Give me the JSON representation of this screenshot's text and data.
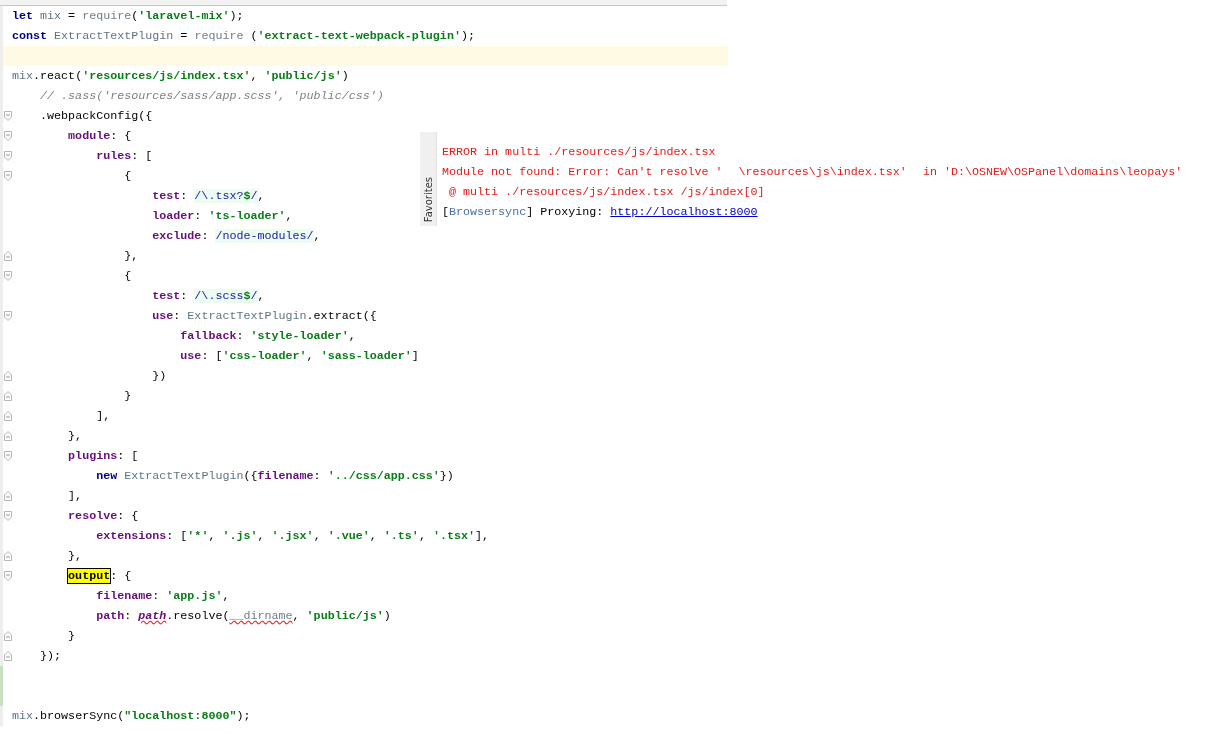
{
  "editor": {
    "lines": [
      {
        "tokens": [
          {
            "kind": "kw",
            "t": "let"
          },
          {
            "kind": "global",
            "t": " mix"
          },
          {
            "kind": "punct",
            "t": " = "
          },
          {
            "kind": "fn",
            "t": "require"
          },
          {
            "kind": "punct",
            "t": "("
          },
          {
            "kind": "str",
            "t": "'laravel-mix'"
          },
          {
            "kind": "punct",
            "t": ");"
          }
        ]
      },
      {
        "tokens": [
          {
            "kind": "kw",
            "t": "const"
          },
          {
            "kind": "global",
            "t": " ExtractTextPlugin"
          },
          {
            "kind": "punct",
            "t": " = "
          },
          {
            "kind": "fn",
            "t": "require"
          },
          {
            "kind": "punct",
            "t": " ("
          },
          {
            "kind": "str",
            "t": "'extract-text-webpack-plugin'"
          },
          {
            "kind": "punct",
            "t": ");"
          }
        ]
      },
      {
        "current": true
      },
      {
        "tokens": [
          {
            "kind": "global",
            "t": "mix"
          },
          {
            "kind": "punct",
            "t": "."
          },
          {
            "kind": "method",
            "t": "react"
          },
          {
            "kind": "punct",
            "t": "("
          },
          {
            "kind": "str",
            "t": "'resources/js/index.tsx'"
          },
          {
            "kind": "punct",
            "t": ", "
          },
          {
            "kind": "str",
            "t": "'public/js'"
          },
          {
            "kind": "punct",
            "t": ")"
          }
        ]
      },
      {
        "tokens": [
          {
            "kind": "comment",
            "t": "    // .sass('resources/sass/app.scss', 'public/css')"
          }
        ]
      },
      {
        "fold_start": true,
        "tokens": [
          {
            "kind": "punct",
            "t": "    ."
          },
          {
            "kind": "method",
            "t": "webpackConfig"
          },
          {
            "kind": "punct",
            "t": "({"
          }
        ]
      },
      {
        "fold_start": true,
        "tokens": [
          {
            "kind": "prop",
            "t": "        module"
          },
          {
            "kind": "punct",
            "t": ": {"
          }
        ]
      },
      {
        "fold_start": true,
        "tokens": [
          {
            "kind": "prop",
            "t": "            rules"
          },
          {
            "kind": "punct",
            "t": ": ["
          }
        ]
      },
      {
        "fold_start": true,
        "tokens": [
          {
            "kind": "punct",
            "t": "                {"
          }
        ]
      },
      {
        "tokens": [
          {
            "kind": "prop",
            "t": "                    test"
          },
          {
            "kind": "punct",
            "t": ": "
          },
          {
            "kind": "regex",
            "t": "/\\.tsx?"
          },
          {
            "kind": "regexop",
            "t": "$"
          },
          {
            "kind": "regex",
            "t": "/"
          },
          {
            "kind": "punct",
            "t": ","
          }
        ]
      },
      {
        "tokens": [
          {
            "kind": "prop",
            "t": "                    loader"
          },
          {
            "kind": "punct",
            "t": ": "
          },
          {
            "kind": "str",
            "t": "'ts-loader'"
          },
          {
            "kind": "punct",
            "t": ","
          }
        ]
      },
      {
        "tokens": [
          {
            "kind": "prop",
            "t": "                    exclude"
          },
          {
            "kind": "punct",
            "t": ": "
          },
          {
            "kind": "regex",
            "t": "/node-modules/"
          },
          {
            "kind": "punct",
            "t": ","
          }
        ]
      },
      {
        "fold_end": true,
        "tokens": [
          {
            "kind": "punct",
            "t": "                },"
          }
        ]
      },
      {
        "fold_start": true,
        "tokens": [
          {
            "kind": "punct",
            "t": "                {"
          }
        ]
      },
      {
        "tokens": [
          {
            "kind": "prop",
            "t": "                    test"
          },
          {
            "kind": "punct",
            "t": ": "
          },
          {
            "kind": "regex",
            "t": "/\\.scss"
          },
          {
            "kind": "regexop",
            "t": "$"
          },
          {
            "kind": "regex",
            "t": "/"
          },
          {
            "kind": "punct",
            "t": ","
          }
        ]
      },
      {
        "fold_start": true,
        "tokens": [
          {
            "kind": "prop",
            "t": "                    use"
          },
          {
            "kind": "punct",
            "t": ": "
          },
          {
            "kind": "global",
            "t": "ExtractTextPlugin"
          },
          {
            "kind": "punct",
            "t": "."
          },
          {
            "kind": "method",
            "t": "extract"
          },
          {
            "kind": "punct",
            "t": "({"
          }
        ]
      },
      {
        "tokens": [
          {
            "kind": "prop",
            "t": "                        fallback"
          },
          {
            "kind": "punct",
            "t": ": "
          },
          {
            "kind": "str",
            "t": "'style-loader'"
          },
          {
            "kind": "punct",
            "t": ","
          }
        ]
      },
      {
        "tokens": [
          {
            "kind": "prop",
            "t": "                        use"
          },
          {
            "kind": "punct",
            "t": ": ["
          },
          {
            "kind": "str",
            "t": "'css-loader'"
          },
          {
            "kind": "punct",
            "t": ", "
          },
          {
            "kind": "str",
            "t": "'sass-loader'"
          },
          {
            "kind": "punct",
            "t": "]"
          }
        ]
      },
      {
        "fold_end": true,
        "tokens": [
          {
            "kind": "punct",
            "t": "                    })"
          }
        ]
      },
      {
        "fold_end": true,
        "tokens": [
          {
            "kind": "punct",
            "t": "                }"
          }
        ]
      },
      {
        "fold_end": true,
        "tokens": [
          {
            "kind": "punct",
            "t": "            ],"
          }
        ]
      },
      {
        "fold_end": true,
        "tokens": [
          {
            "kind": "punct",
            "t": "        },"
          }
        ]
      },
      {
        "fold_start": true,
        "tokens": [
          {
            "kind": "prop",
            "t": "        plugins"
          },
          {
            "kind": "punct",
            "t": ": ["
          }
        ]
      },
      {
        "tokens": [
          {
            "kind": "kw",
            "t": "            new"
          },
          {
            "kind": "global",
            "t": " ExtractTextPlugin"
          },
          {
            "kind": "punct",
            "t": "({"
          },
          {
            "kind": "prop",
            "t": "filename"
          },
          {
            "kind": "punct",
            "t": ": "
          },
          {
            "kind": "str",
            "t": "'../css/app.css'"
          },
          {
            "kind": "punct",
            "t": "})"
          }
        ]
      },
      {
        "fold_end": true,
        "tokens": [
          {
            "kind": "punct",
            "t": "        ],"
          }
        ]
      },
      {
        "fold_start": true,
        "tokens": [
          {
            "kind": "prop",
            "t": "        resolve"
          },
          {
            "kind": "punct",
            "t": ": {"
          }
        ]
      },
      {
        "tokens": [
          {
            "kind": "prop",
            "t": "            extensions"
          },
          {
            "kind": "punct",
            "t": ": ["
          },
          {
            "kind": "str",
            "t": "'*'"
          },
          {
            "kind": "punct",
            "t": ", "
          },
          {
            "kind": "str",
            "t": "'.js'"
          },
          {
            "kind": "punct",
            "t": ", "
          },
          {
            "kind": "str",
            "t": "'.jsx'"
          },
          {
            "kind": "punct",
            "t": ", "
          },
          {
            "kind": "str",
            "t": "'.vue'"
          },
          {
            "kind": "punct",
            "t": ", "
          },
          {
            "kind": "str",
            "t": "'.ts'"
          },
          {
            "kind": "punct",
            "t": ", "
          },
          {
            "kind": "str",
            "t": "'.tsx'"
          },
          {
            "kind": "punct",
            "t": "],"
          }
        ]
      },
      {
        "fold_end": true,
        "tokens": [
          {
            "kind": "punct",
            "t": "        },"
          }
        ]
      },
      {
        "fold_start": true,
        "tokens": [
          {
            "kind": "hl",
            "t": "        output"
          },
          {
            "kind": "punct",
            "t": ": {"
          }
        ]
      },
      {
        "tokens": [
          {
            "kind": "prop",
            "t": "            filename"
          },
          {
            "kind": "punct",
            "t": ": "
          },
          {
            "kind": "str",
            "t": "'app.js'"
          },
          {
            "kind": "punct",
            "t": ","
          }
        ]
      },
      {
        "tokens": [
          {
            "kind": "prop",
            "t": "            path"
          },
          {
            "kind": "punct",
            "t": ": "
          },
          {
            "kind": "warn",
            "t": "path"
          },
          {
            "kind": "punct",
            "t": "."
          },
          {
            "kind": "method",
            "t": "resolve"
          },
          {
            "kind": "punct",
            "t": "("
          },
          {
            "kind": "warnplain",
            "t": "__dirname"
          },
          {
            "kind": "punct",
            "t": ", "
          },
          {
            "kind": "str",
            "t": "'public/js'"
          },
          {
            "kind": "punct",
            "t": ")"
          }
        ]
      },
      {
        "fold_end": true,
        "tokens": [
          {
            "kind": "punct",
            "t": "        }"
          }
        ]
      },
      {
        "fold_end": true,
        "tokens": [
          {
            "kind": "punct",
            "t": "    });"
          }
        ]
      },
      {
        "changed": true
      },
      {
        "changed": true
      },
      {
        "tokens": [
          {
            "kind": "global",
            "t": "mix"
          },
          {
            "kind": "punct",
            "t": "."
          },
          {
            "kind": "method",
            "t": "browserSync"
          },
          {
            "kind": "punct",
            "t": "("
          },
          {
            "kind": "str",
            "t": "\"localhost:8000\""
          },
          {
            "kind": "punct",
            "t": ");"
          }
        ]
      }
    ]
  },
  "console": {
    "side_tab": "Favorites",
    "lines": [
      {
        "parts": [
          {
            "kind": "error",
            "text": "ERROR in multi ./resources/js/index.tsx"
          }
        ]
      },
      {
        "parts": [
          {
            "kind": "error",
            "text": "Module not found: Error: Can't resolve '"
          },
          {
            "kind": "error",
            "spaced": true,
            "text": "\\resources\\js\\index.tsx'"
          },
          {
            "kind": "error",
            "spaced": true,
            "text": "in 'D:\\OSNEW\\OSPanel\\domains\\leopays'"
          }
        ]
      },
      {
        "parts": [
          {
            "kind": "error",
            "text": " @ multi ./resources/js/index.tsx /js/index[0]"
          }
        ]
      },
      {
        "parts": [
          {
            "kind": "plain",
            "text": "["
          },
          {
            "kind": "tag",
            "text": "Browsersync"
          },
          {
            "kind": "plain",
            "text": "] Proxying:"
          },
          {
            "kind": "link",
            "spaced": true,
            "text": "http://localhost:8000"
          }
        ]
      }
    ]
  }
}
